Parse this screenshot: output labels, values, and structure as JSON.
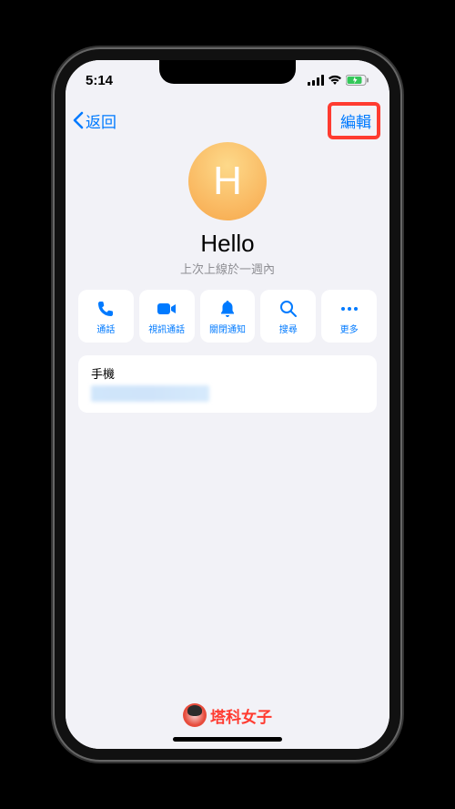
{
  "status_bar": {
    "time": "5:14"
  },
  "nav": {
    "back_label": "返回",
    "edit_label": "編輯"
  },
  "contact": {
    "initial": "H",
    "name": "Hello",
    "subtitle": "上次上線於一週內"
  },
  "actions": [
    {
      "id": "call",
      "label": "通話"
    },
    {
      "id": "video",
      "label": "視訊通話"
    },
    {
      "id": "mute",
      "label": "關閉通知"
    },
    {
      "id": "search",
      "label": "搜尋"
    },
    {
      "id": "more",
      "label": "更多"
    }
  ],
  "info": {
    "phone_label": "手機"
  },
  "watermark": {
    "text": "塔科女子"
  }
}
